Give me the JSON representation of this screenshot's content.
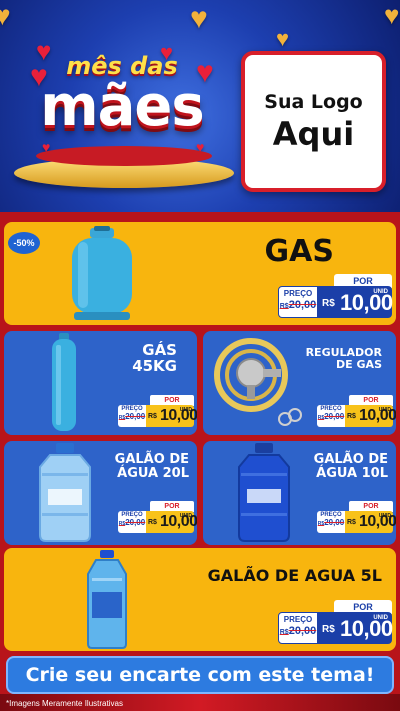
{
  "header": {
    "title_line1": "mês das",
    "title_line2": "mães",
    "logo_line1": "Sua Logo",
    "logo_line2": "Aqui"
  },
  "badge": "-50%",
  "products": [
    {
      "title": "GAS",
      "price_label": "PREÇO",
      "old_price": "20,00",
      "old_prefix": "R$",
      "por": "POR",
      "currency": "R$",
      "price": "10,00",
      "unit": "UNID"
    },
    {
      "title": "GÁS 45KG",
      "price_label": "PREÇO",
      "old_price": "20,00",
      "old_prefix": "R$",
      "por": "POR",
      "currency": "R$",
      "price": "10,00",
      "unit": "UNID"
    },
    {
      "title": "REGULADOR DE GAS",
      "price_label": "PREÇO",
      "old_price": "20,00",
      "old_prefix": "R$",
      "por": "POR",
      "currency": "R$",
      "price": "10,00",
      "unit": "UNID"
    },
    {
      "title": "GALÃO DE ÁGUA 20L",
      "price_label": "PREÇO",
      "old_price": "20,00",
      "old_prefix": "R$",
      "por": "POR",
      "currency": "R$",
      "price": "10,00",
      "unit": "UNID"
    },
    {
      "title": "GALÃO DE ÁGUA 10L",
      "price_label": "PREÇO",
      "old_price": "20,00",
      "old_prefix": "R$",
      "por": "POR",
      "currency": "R$",
      "price": "10,00",
      "unit": "UNID"
    },
    {
      "title": "GALÃO DE AGUA 5L",
      "price_label": "PREÇO",
      "old_price": "20,00",
      "old_prefix": "R$",
      "por": "POR",
      "currency": "R$",
      "price": "10,00",
      "unit": "UNID"
    }
  ],
  "cta": "Crie seu encarte com este tema!",
  "footnote": "*Imagens Meramente Ilustrativas",
  "colors": {
    "yellow": "#f8b50e",
    "blue": "#2e63c9",
    "red": "#b8141a",
    "navy": "#1b3fa8"
  }
}
